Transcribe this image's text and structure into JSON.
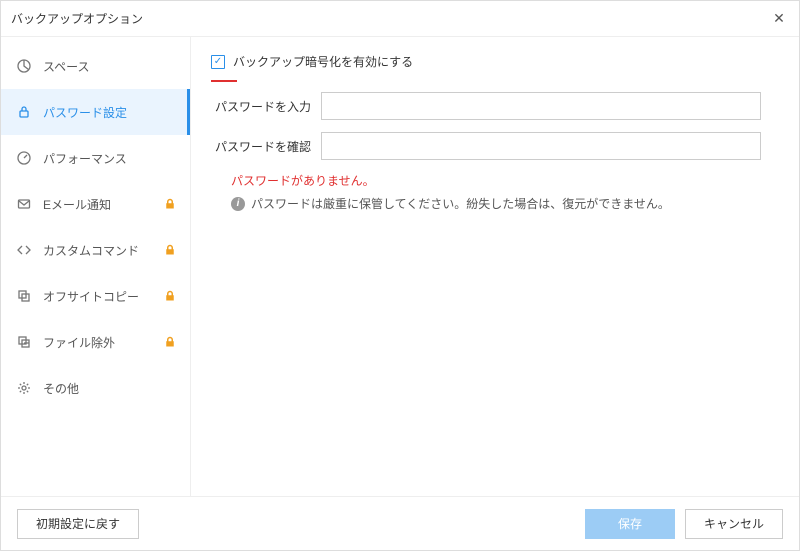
{
  "window": {
    "title": "バックアップオプション"
  },
  "sidebar": {
    "items": [
      {
        "label": "スペース",
        "locked": false
      },
      {
        "label": "パスワード設定",
        "locked": false
      },
      {
        "label": "パフォーマンス",
        "locked": false
      },
      {
        "label": "Eメール通知",
        "locked": true
      },
      {
        "label": "カスタムコマンド",
        "locked": true
      },
      {
        "label": "オフサイトコピー",
        "locked": true
      },
      {
        "label": "ファイル除外",
        "locked": true
      },
      {
        "label": "その他",
        "locked": false
      }
    ]
  },
  "content": {
    "enable_encryption_label": "バックアップ暗号化を有効にする",
    "password_input_label": "パスワードを入力",
    "password_confirm_label": "パスワードを確認",
    "password_error": "パスワードがありません。",
    "password_hint": "パスワードは厳重に保管してください。紛失した場合は、復元ができません。"
  },
  "footer": {
    "reset_label": "初期設定に戻す",
    "save_label": "保存",
    "cancel_label": "キャンセル"
  }
}
